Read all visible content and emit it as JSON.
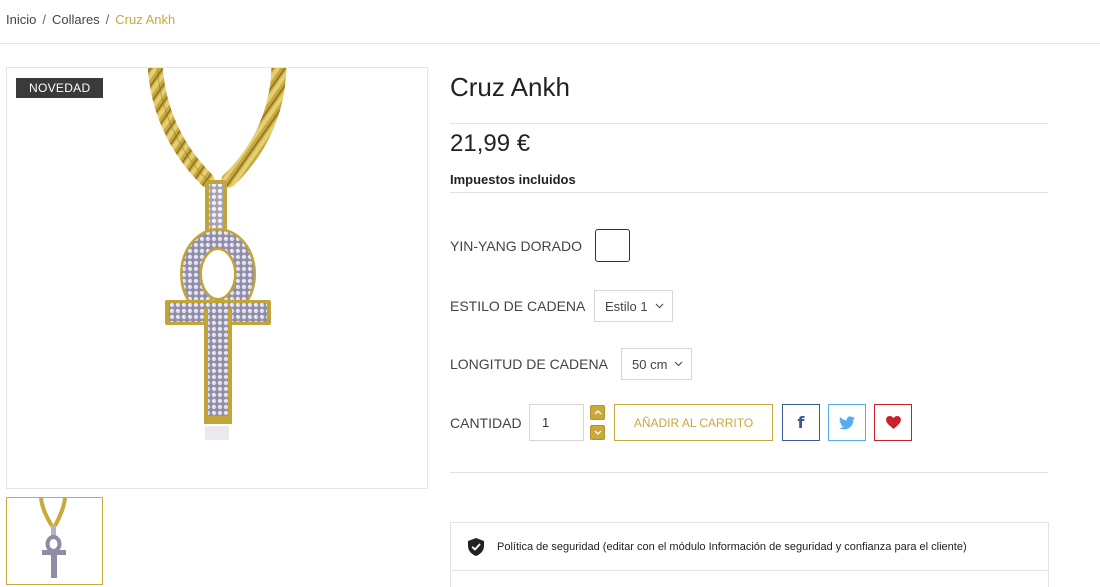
{
  "breadcrumb": {
    "home": "Inicio",
    "category": "Collares",
    "current": "Cruz Ankh",
    "separator": "/"
  },
  "product": {
    "badge": "NOVEDAD",
    "title": "Cruz Ankh",
    "price": "21,99 €",
    "tax_note": "Impuestos incluidos"
  },
  "options": {
    "color_label": "YIN-YANG DORADO",
    "chain_style_label": "ESTILO DE CADENA",
    "chain_style_value": "Estilo 1",
    "chain_length_label": "LONGITUD DE CADENA",
    "chain_length_value": "50 cm"
  },
  "cart": {
    "quantity_label": "CANTIDAD",
    "quantity_value": "1",
    "add_to_cart_label": "AÑADIR AL CARRITO"
  },
  "social": {
    "facebook_glyph": "f"
  },
  "reassurance": {
    "policy_text": "Política de seguridad (editar con el módulo Información de seguridad y confianza para el cliente)"
  },
  "colors": {
    "accent": "#c9a83c",
    "badge_bg": "#3a3a3a",
    "facebook": "#3b5998",
    "twitter": "#55acee",
    "pinterest": "#cb2027"
  },
  "icons": [
    "chevron-down-icon",
    "chevron-up-icon",
    "twitter-icon",
    "heart-icon",
    "shield-check-icon"
  ]
}
